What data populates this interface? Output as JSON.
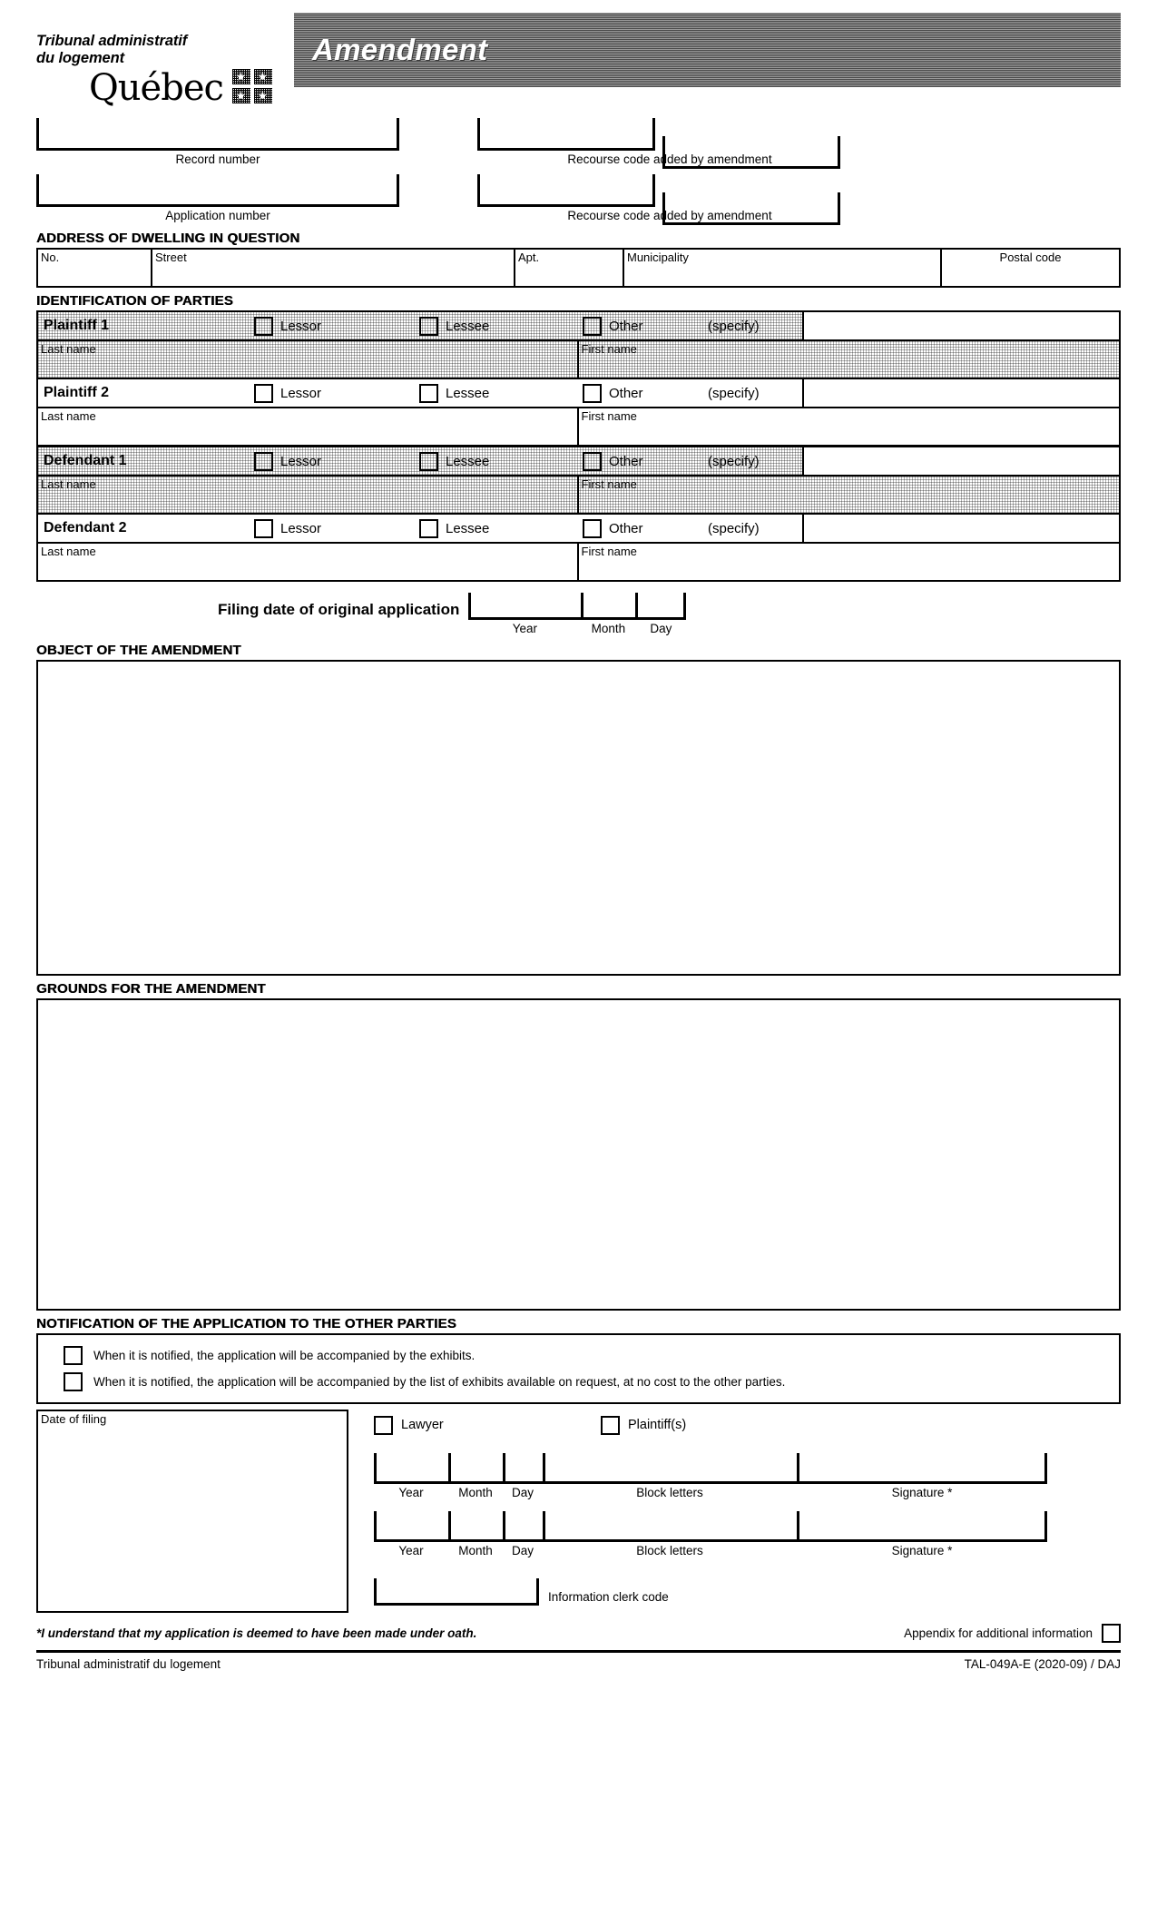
{
  "header": {
    "org_line1": "Tribunal administratif",
    "org_line2": "du logement",
    "wordmark": "Québec",
    "form_title": "Amendment"
  },
  "top_fields": {
    "record_number_label": "Record number",
    "application_number_label": "Application number",
    "recourse_code_added_label_1": "Recourse code added by amendment",
    "recourse_code_added_label_2": "Recourse code added by amendment",
    "record_number_value": "",
    "application_number_value": "",
    "recourse_code_1a_value": "",
    "recourse_code_1b_value": "",
    "recourse_code_2a_value": "",
    "recourse_code_2b_value": ""
  },
  "address_section": {
    "title": "ADDRESS OF DWELLING IN QUESTION",
    "columns": [
      {
        "label": "No.",
        "value": ""
      },
      {
        "label": "Street",
        "value": ""
      },
      {
        "label": "Apt.",
        "value": ""
      },
      {
        "label": "Municipality",
        "value": ""
      },
      {
        "label": "Postal code",
        "value": ""
      }
    ]
  },
  "parties_section": {
    "title": "IDENTIFICATION OF PARTIES",
    "options": [
      "Lessor",
      "Lessee",
      "Other"
    ],
    "specify_label": "(specify)",
    "last_name_label": "Last name",
    "first_name_label": "First name",
    "parties": [
      {
        "name": "Plaintiff 1",
        "shaded": true,
        "specify_value": "",
        "last_name_value": "",
        "first_name_value": ""
      },
      {
        "name": "Plaintiff 2",
        "shaded": false,
        "specify_value": "",
        "last_name_value": "",
        "first_name_value": ""
      },
      {
        "name": "Defendant 1",
        "shaded": true,
        "specify_value": "",
        "last_name_value": "",
        "first_name_value": ""
      },
      {
        "name": "Defendant 2",
        "shaded": false,
        "specify_value": "",
        "last_name_value": "",
        "first_name_value": ""
      }
    ]
  },
  "filing_date": {
    "label": "Filing date of original application",
    "year_label": "Year",
    "month_label": "Month",
    "day_label": "Day",
    "year_value": "",
    "month_value": "",
    "day_value": ""
  },
  "object_section": {
    "title": "OBJECT OF THE AMENDMENT",
    "value": ""
  },
  "grounds_section": {
    "title": "GROUNDS FOR THE AMENDMENT",
    "value": ""
  },
  "notification_section": {
    "title": "NOTIFICATION OF THE APPLICATION TO THE OTHER PARTIES",
    "options": [
      {
        "text": "When it is notified, the application will be accompanied by the exhibits.",
        "checked": false
      },
      {
        "text": "When it is notified, the application will be accompanied by the list of exhibits available on request, at no cost to the other parties.",
        "checked": false
      }
    ]
  },
  "signature_section": {
    "date_of_filing_label": "Date of filing",
    "date_of_filing_value": "",
    "signer_options": [
      {
        "label": "Lawyer",
        "checked": false
      },
      {
        "label": "Plaintiff(s)",
        "checked": false
      }
    ],
    "rows": [
      {
        "year_label": "Year",
        "month_label": "Month",
        "day_label": "Day",
        "block_letters_label": "Block letters",
        "signature_label": "Signature *",
        "year_value": "",
        "month_value": "",
        "day_value": "",
        "block_letters_value": "",
        "signature_value": ""
      },
      {
        "year_label": "Year",
        "month_label": "Month",
        "day_label": "Day",
        "block_letters_label": "Block letters",
        "signature_label": "Signature *",
        "year_value": "",
        "month_value": "",
        "day_value": "",
        "block_letters_value": "",
        "signature_value": ""
      }
    ],
    "clerk_code_label": "Information clerk code",
    "clerk_code_value": ""
  },
  "footer": {
    "oath_note": "*I understand that my application is deemed to have been made under oath.",
    "appendix_label": "Appendix for additional information",
    "appendix_checked": false,
    "org_name": "Tribunal administratif du logement",
    "form_code": "TAL-049A-E (2020-09) / DAJ"
  }
}
